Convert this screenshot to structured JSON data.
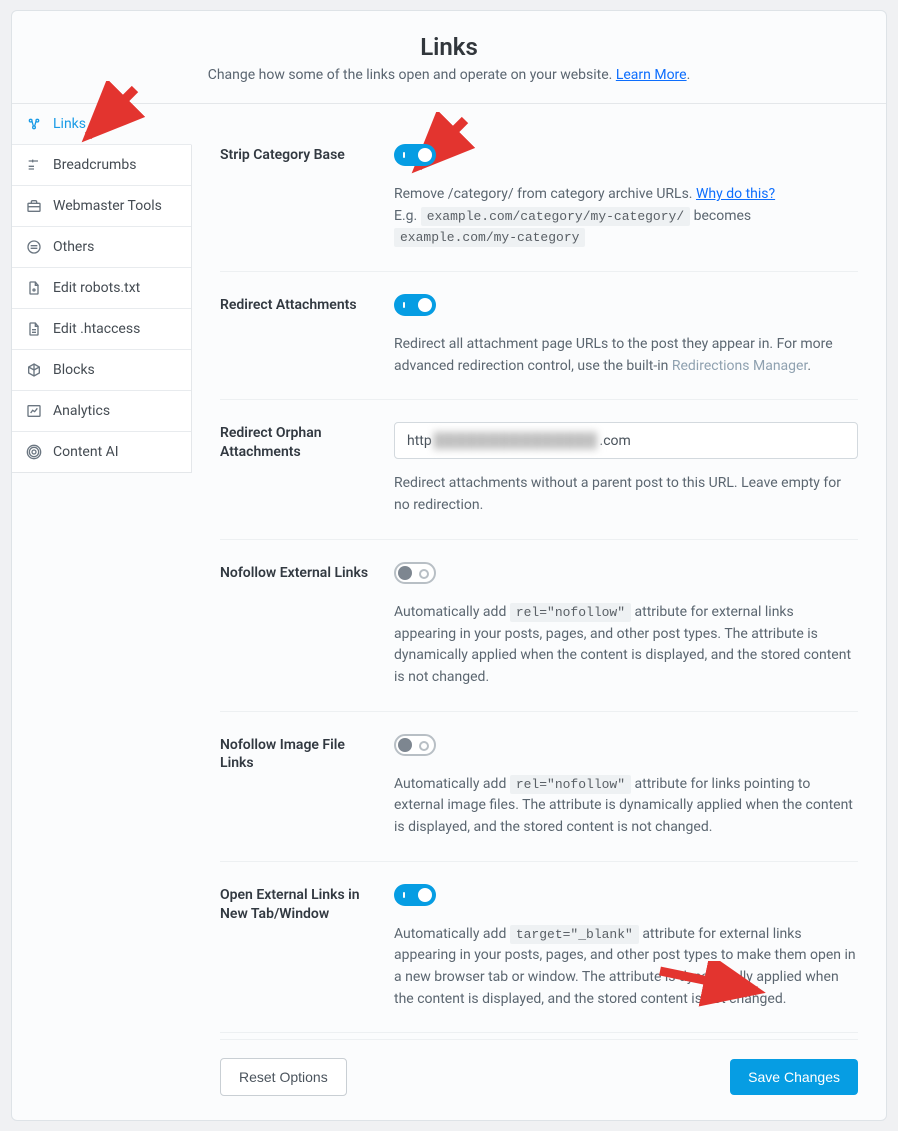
{
  "header": {
    "title": "Links",
    "subtitle": "Change how some of the links open and operate on your website. ",
    "learn_more": "Learn More"
  },
  "sidebar": {
    "items": [
      {
        "label": "Links",
        "active": true,
        "icon": "links-icon"
      },
      {
        "label": "Breadcrumbs",
        "active": false,
        "icon": "breadcrumb-icon"
      },
      {
        "label": "Webmaster Tools",
        "active": false,
        "icon": "toolbox-icon"
      },
      {
        "label": "Others",
        "active": false,
        "icon": "others-icon"
      },
      {
        "label": "Edit robots.txt",
        "active": false,
        "icon": "robots-icon"
      },
      {
        "label": "Edit .htaccess",
        "active": false,
        "icon": "htaccess-icon"
      },
      {
        "label": "Blocks",
        "active": false,
        "icon": "blocks-icon"
      },
      {
        "label": "Analytics",
        "active": false,
        "icon": "analytics-icon"
      },
      {
        "label": "Content AI",
        "active": false,
        "icon": "content-ai-icon"
      }
    ]
  },
  "settings": {
    "strip_category_base": {
      "label": "Strip Category Base",
      "enabled": true,
      "desc_pre": "Remove /category/ from category archive URLs. ",
      "link": "Why do this?",
      "eg_label": "E.g. ",
      "code1": "example.com/category/my-category/",
      "mid": " becomes ",
      "code2": "example.com/my-category"
    },
    "redirect_attachments": {
      "label": "Redirect Attachments",
      "enabled": true,
      "desc_pre": "Redirect all attachment page URLs to the post they appear in. For more advanced redirection control, use the built-in  ",
      "link": "Redirections Manager",
      "desc_post": "."
    },
    "redirect_orphan": {
      "label": "Redirect Orphan Attachments",
      "value_prefix": "http",
      "value_blurred": "███████████████",
      "value_suffix": ".com",
      "desc": "Redirect attachments without a parent post to this URL. Leave empty for no redirection."
    },
    "nofollow_external": {
      "label": "Nofollow External Links",
      "enabled": false,
      "desc_pre": "Automatically add ",
      "code": "rel=\"nofollow\"",
      "desc_post": " attribute for external links appearing in your posts, pages, and other post types. The attribute is dynamically applied when the content is displayed, and the stored content is not changed."
    },
    "nofollow_image": {
      "label": "Nofollow Image File Links",
      "enabled": false,
      "desc_pre": "Automatically add ",
      "code": "rel=\"nofollow\"",
      "desc_post": " attribute for links pointing to external image files. The attribute is dynamically applied when the content is displayed, and the stored content is not changed."
    },
    "open_new_tab": {
      "label": "Open External Links in New Tab/Window",
      "enabled": true,
      "desc_pre": "Automatically add ",
      "code": "target=\"_blank\"",
      "desc_post": " attribute for external links appearing in your posts, pages, and other post types to make them open in a new browser tab or window. The attribute is dynamically applied when the content is displayed, and the stored content is not changed."
    }
  },
  "footer": {
    "reset": "Reset Options",
    "save": "Save Changes"
  }
}
